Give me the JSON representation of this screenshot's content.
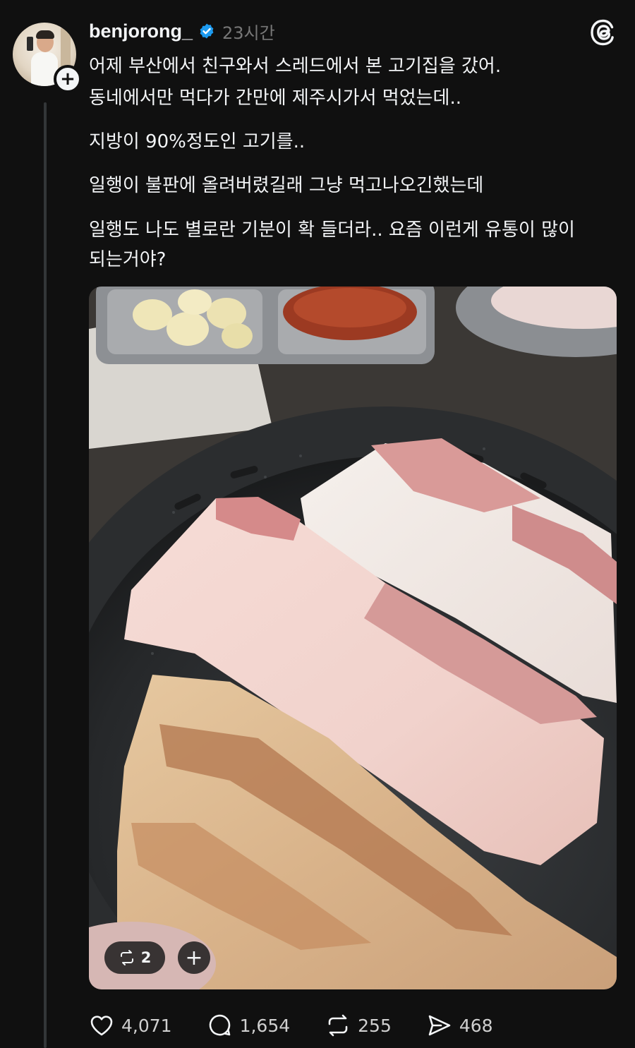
{
  "post": {
    "username": "benjorong_",
    "timestamp": "23시간",
    "verified_color": "#1d9bf0",
    "paragraphs": {
      "p1_line1": "어제 부산에서 친구와서 스레드에서 본 고기집을 갔어.",
      "p1_line2": "동네에서만 먹다가 간만에 제주시가서 먹었는데..",
      "p2": "지방이 90%정도인 고기를..",
      "p3": "일행이 불판에 올려버렸길래 그냥 먹고나오긴했는데",
      "p4_line1": "일행도 나도 별로란 기분이 확 들더라.. 요즘 이런게 유통이 많이",
      "p4_line2": "되는거야?"
    },
    "photo": {
      "description_icon": "grilled-pork-belly-photo",
      "repost_count": "2"
    },
    "actions": {
      "likes": "4,071",
      "replies": "1,654",
      "reposts": "255",
      "shares": "468"
    }
  },
  "icons": {
    "verified": "verified-badge-icon",
    "threads": "threads-logo-icon",
    "like": "heart-icon",
    "reply": "comment-icon",
    "repost": "repost-icon",
    "share": "send-icon",
    "follow": "plus-icon"
  },
  "colors": {
    "background": "#101010",
    "text": "#f3f5f7",
    "muted": "#777777"
  }
}
